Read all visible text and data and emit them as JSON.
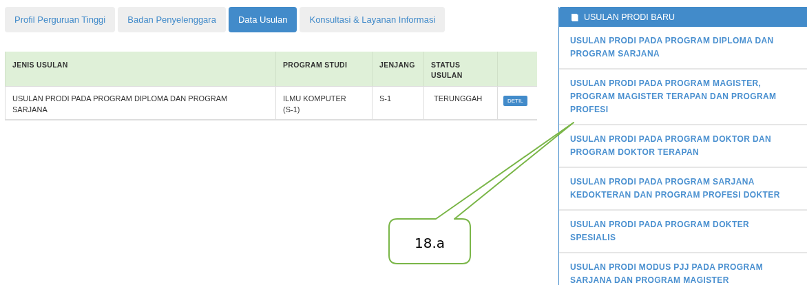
{
  "tabs": [
    {
      "label": "Profil Perguruan Tinggi",
      "selected": false
    },
    {
      "label": "Badan Penyelenggara",
      "selected": false
    },
    {
      "label": "Data Usulan",
      "selected": true
    },
    {
      "label": "Konsultasi & Layanan Informasi",
      "selected": false
    }
  ],
  "table": {
    "columns": [
      "JENIS USULAN",
      "PROGRAM STUDI",
      "JENJANG",
      "STATUS USULAN"
    ],
    "rows": [
      {
        "cells": [
          "USULAN PRODI PADA PROGRAM DIPLOMA DAN PROGRAM SARJANA",
          "ILMU KOMPUTER (S-1)",
          "S-1",
          "TERUNGGAH"
        ],
        "action": "DETIL"
      }
    ]
  },
  "panel": {
    "title": "USULAN PRODI BARU",
    "items": [
      "USULAN PRODI PADA PROGRAM DIPLOMA DAN PROGRAM SARJANA",
      "USULAN PRODI PADA PROGRAM MAGISTER, PROGRAM MAGISTER TERAPAN DAN PROGRAM PROFESI",
      "USULAN PRODI PADA PROGRAM DOKTOR DAN PROGRAM DOKTOR TERAPAN",
      "USULAN PRODI PADA PROGRAM SARJANA KEDOKTERAN DAN PROGRAM PROFESI DOKTER",
      "USULAN PRODI PADA PROGRAM DOKTER SPESIALIS",
      "USULAN PRODI MODUS PJJ PADA PROGRAM SARJANA DAN PROGRAM MAGISTER"
    ]
  },
  "callout": {
    "label": "18.a"
  }
}
